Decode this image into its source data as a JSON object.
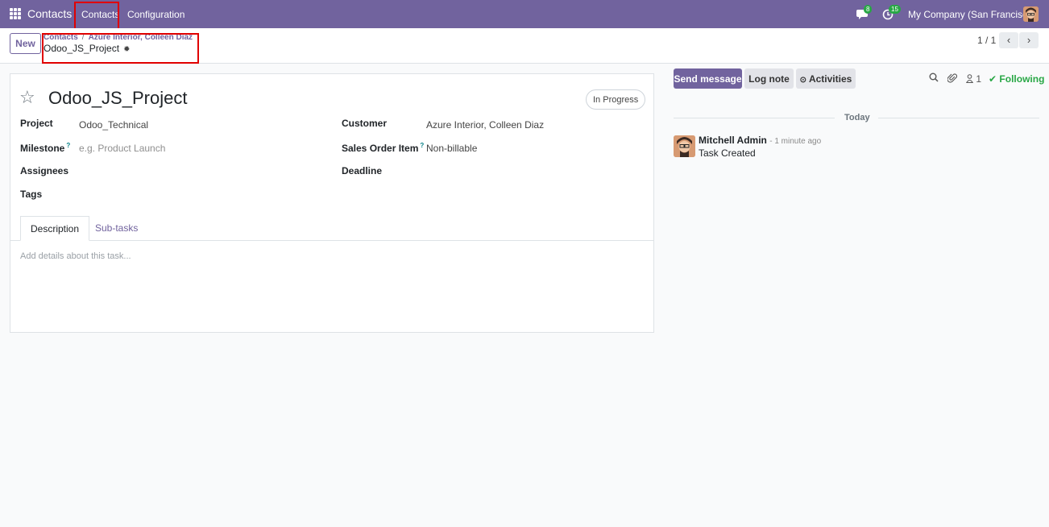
{
  "navbar": {
    "app_name": "Contacts",
    "menus": [
      "Contacts",
      "Configuration"
    ],
    "messages_count": "8",
    "activities_count": "15",
    "company": "My Company (San Francisco)"
  },
  "control_panel": {
    "new_label": "New",
    "breadcrumbs": [
      "Contacts",
      "Azure Interior, Colleen Diaz"
    ],
    "breadcrumb_sep": "/",
    "record_name": "Odoo_JS_Project",
    "pager": "1 / 1"
  },
  "form": {
    "title": "Odoo_JS_Project",
    "stage": "In Progress",
    "fields": {
      "project_label": "Project",
      "project_value": "Odoo_Technical",
      "milestone_label": "Milestone",
      "milestone_placeholder": "e.g. Product Launch",
      "assignees_label": "Assignees",
      "tags_label": "Tags",
      "customer_label": "Customer",
      "customer_value": "Azure Interior, Colleen Diaz",
      "sales_order_label": "Sales Order Item",
      "sales_order_value": "Non-billable",
      "deadline_label": "Deadline",
      "help_mark": "?"
    },
    "tabs": [
      "Description",
      "Sub-tasks"
    ],
    "description_placeholder": "Add details about this task..."
  },
  "chatter": {
    "send_message": "Send message",
    "log_note": "Log note",
    "activities": "Activities",
    "followers_count": "1",
    "following": "Following",
    "date_separator": "Today",
    "message": {
      "author": "Mitchell Admin",
      "time": "- 1 minute ago",
      "body": "Task Created"
    }
  },
  "colors": {
    "primary": "#71639e",
    "success": "#28a745",
    "highlight": "#e00000"
  }
}
